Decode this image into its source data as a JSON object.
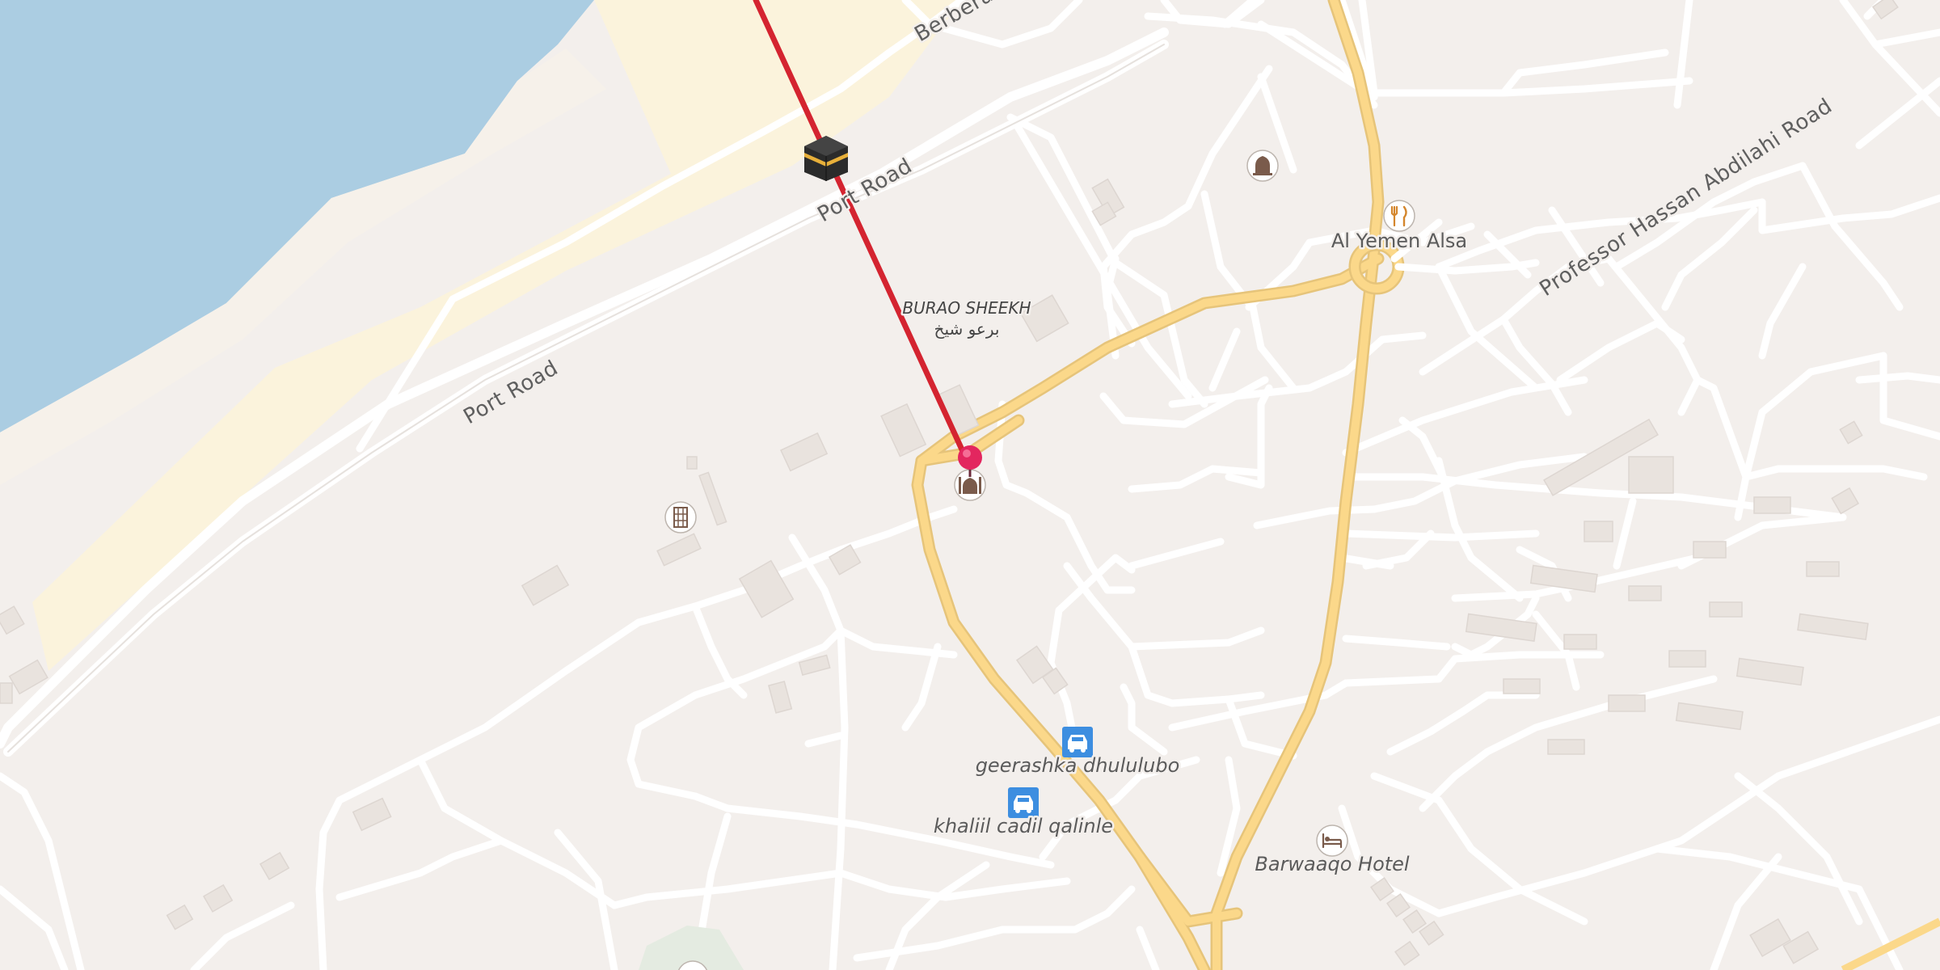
{
  "map": {
    "roads": {
      "berbera_port_road": "Berbera Port Road",
      "port_road_1": "Port Road",
      "port_road_2": "Port Road",
      "professor_road": "Professor Hassan Abdilahi Road"
    },
    "places": {
      "burao_sheekh": "BURAO SHEEKH",
      "burao_sheekh_ar": "برعو شيخ"
    },
    "pois": [
      {
        "name": "Al Yemen Alsa",
        "icon": "restaurant-icon"
      },
      {
        "name": "geerashka dhululubo",
        "icon": "car-icon"
      },
      {
        "name": "khaliil cadil qalinle",
        "icon": "car-icon"
      },
      {
        "name": "Barwaaqo Hotel",
        "icon": "hotel-icon"
      }
    ],
    "markers": {
      "qibla": "kaaba-icon",
      "mosque_main": "mosque-icon",
      "mosque_ne": "mosque-icon",
      "building_west": "building-icon",
      "pin": "map-pin-icon"
    },
    "colors": {
      "water": "#abcde2",
      "land": "#f3efec",
      "beach": "#fbf3dc",
      "major_road": "#fbd88a",
      "qibla_line": "#d42430",
      "pin": "#e3265f",
      "parking": "#3d8ee0"
    }
  }
}
